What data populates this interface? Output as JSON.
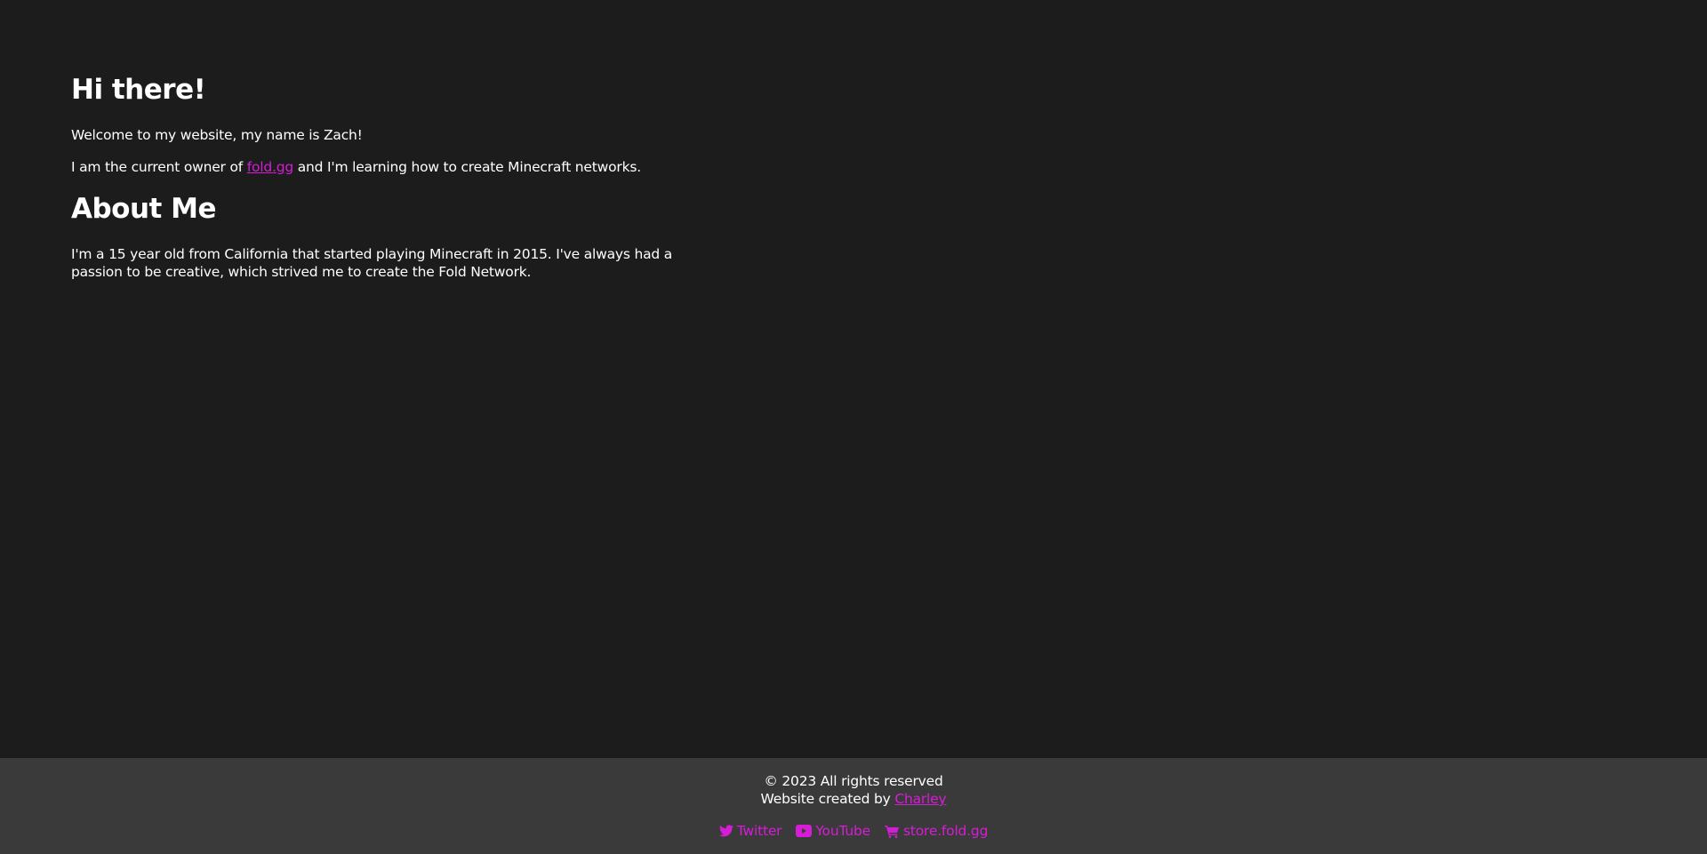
{
  "main": {
    "heading_greeting": "Hi there!",
    "welcome_text": "Welcome to my website, my name is Zach!",
    "owner_text_prefix": "I am the current owner of ",
    "owner_link": "fold.gg",
    "owner_text_suffix": " and I'm learning how to create Minecraft networks.",
    "heading_about": "About Me",
    "about_text": "I'm a 15 year old from California that started playing Minecraft in 2015. I've always had a passion to be creative, which strived me to create the Fold Network."
  },
  "footer": {
    "copyright": "© 2023 All rights reserved",
    "credit_prefix": "Website created by ",
    "credit_link": "Charley",
    "social": [
      {
        "label": "Twitter",
        "icon": "twitter-icon"
      },
      {
        "label": "YouTube",
        "icon": "youtube-icon"
      },
      {
        "label": "store.fold.gg",
        "icon": "shopping-cart-icon"
      }
    ]
  },
  "colors": {
    "background": "#1c1c1c",
    "footer_background": "#3a3a3a",
    "text": "#ffffff",
    "accent": "#d61dd6"
  }
}
